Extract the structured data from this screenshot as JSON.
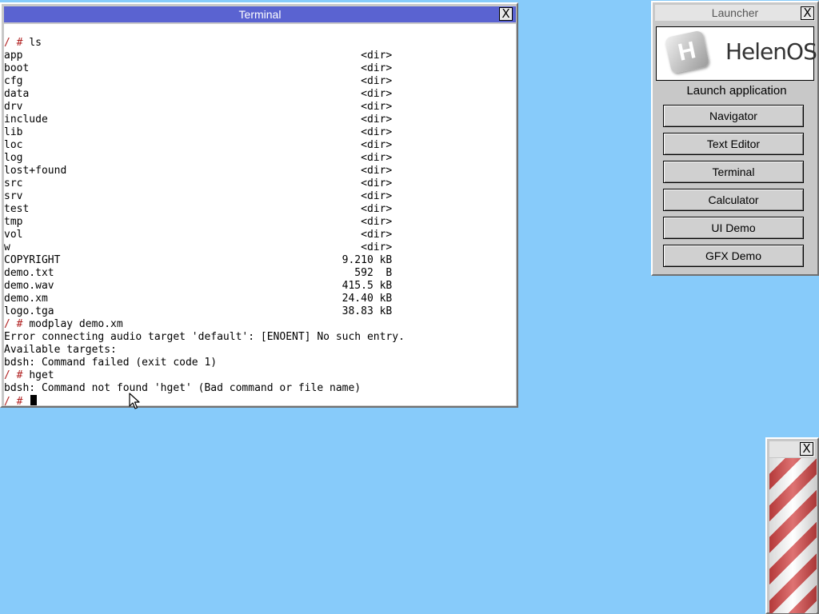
{
  "terminal": {
    "title": "Terminal",
    "close_label": "X",
    "lines": [
      {
        "prompt": "/ # ",
        "text": "ls"
      },
      {
        "prompt": "",
        "text": "app                                                      <dir>"
      },
      {
        "prompt": "",
        "text": "boot                                                     <dir>"
      },
      {
        "prompt": "",
        "text": "cfg                                                      <dir>"
      },
      {
        "prompt": "",
        "text": "data                                                     <dir>"
      },
      {
        "prompt": "",
        "text": "drv                                                      <dir>"
      },
      {
        "prompt": "",
        "text": "include                                                  <dir>"
      },
      {
        "prompt": "",
        "text": "lib                                                      <dir>"
      },
      {
        "prompt": "",
        "text": "loc                                                      <dir>"
      },
      {
        "prompt": "",
        "text": "log                                                      <dir>"
      },
      {
        "prompt": "",
        "text": "lost+found                                               <dir>"
      },
      {
        "prompt": "",
        "text": "src                                                      <dir>"
      },
      {
        "prompt": "",
        "text": "srv                                                      <dir>"
      },
      {
        "prompt": "",
        "text": "test                                                     <dir>"
      },
      {
        "prompt": "",
        "text": "tmp                                                      <dir>"
      },
      {
        "prompt": "",
        "text": "vol                                                      <dir>"
      },
      {
        "prompt": "",
        "text": "w                                                        <dir>"
      },
      {
        "prompt": "",
        "text": "COPYRIGHT                                             9.210 kB"
      },
      {
        "prompt": "",
        "text": "demo.txt                                                592  B"
      },
      {
        "prompt": "",
        "text": "demo.wav                                              415.5 kB"
      },
      {
        "prompt": "",
        "text": "demo.xm                                               24.40 kB"
      },
      {
        "prompt": "",
        "text": "logo.tga                                              38.83 kB"
      },
      {
        "prompt": "/ # ",
        "text": "modplay demo.xm"
      },
      {
        "prompt": "",
        "text": "Error connecting audio target 'default': [ENOENT] No such entry."
      },
      {
        "prompt": "",
        "text": "Available targets:"
      },
      {
        "prompt": "",
        "text": "bdsh: Command failed (exit code 1)"
      },
      {
        "prompt": "/ # ",
        "text": "hget"
      },
      {
        "prompt": "",
        "text": "bdsh: Command not found 'hget' (Bad command or file name)"
      },
      {
        "prompt": "/ # ",
        "text": "",
        "cursor": true
      }
    ]
  },
  "launcher": {
    "title": "Launcher",
    "close_label": "X",
    "logo_text": "HelenOS",
    "logo_letter": "H",
    "heading": "Launch application",
    "buttons": [
      {
        "name": "navigator",
        "label": "Navigator"
      },
      {
        "name": "text-editor",
        "label": "Text Editor"
      },
      {
        "name": "terminal",
        "label": "Terminal"
      },
      {
        "name": "calculator",
        "label": "Calculator"
      },
      {
        "name": "ui-demo",
        "label": "UI Demo"
      },
      {
        "name": "gfx-demo",
        "label": "GFX Demo"
      }
    ]
  },
  "barber": {
    "close_label": "X"
  },
  "colors": {
    "desktop": "#87cbfa",
    "terminal_titlebar": "#5a63d1",
    "prompt": "#b02020"
  }
}
